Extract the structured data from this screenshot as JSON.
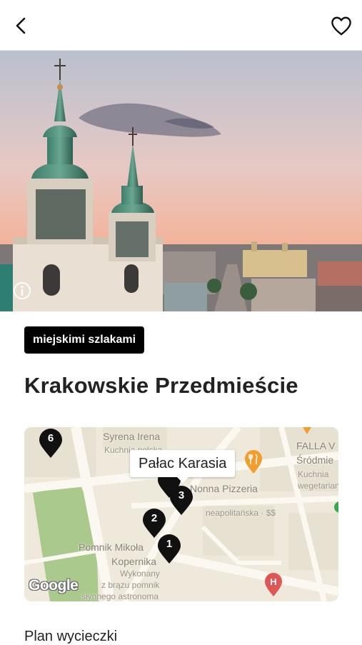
{
  "header": {
    "back_icon": "chevron-left-icon",
    "favorite_icon": "heart-outline-icon"
  },
  "hero": {
    "info_icon": "info-circle-icon"
  },
  "tag": {
    "label": "miejskimi szlakami"
  },
  "page": {
    "title": "Krakowskie Przedmieście"
  },
  "map": {
    "callout": "Pałac Karasia",
    "labels": {
      "syrena": "Syrena Irena",
      "syrena_sub": "Kuchnia polska",
      "falla": "FALLA V",
      "srodmiescie": "Śródmie",
      "kuchnia": "Kuchnia",
      "wegetarian": "wegetarian",
      "nonna": "Nonna Pizzeria",
      "nonna_sub": "neapolitańska · $$",
      "pomnik1": "Pomnik Mikoła",
      "pomnik2": "Kopernika",
      "pomnik_sub1": "Wykonany",
      "pomnik_sub2": "z brązu pomnik",
      "pomnik_sub3": "słynnego astronoma"
    },
    "pins": [
      {
        "number": "6"
      },
      {
        "number": "3"
      },
      {
        "number": "2"
      },
      {
        "number": "1"
      }
    ],
    "attribution": "Google",
    "colors": {
      "pin": "#111111",
      "restaurant": "#f29e2e",
      "hospital": "#e05656",
      "park": "#a9c98d"
    }
  },
  "section": {
    "title": "Plan wycieczki"
  }
}
